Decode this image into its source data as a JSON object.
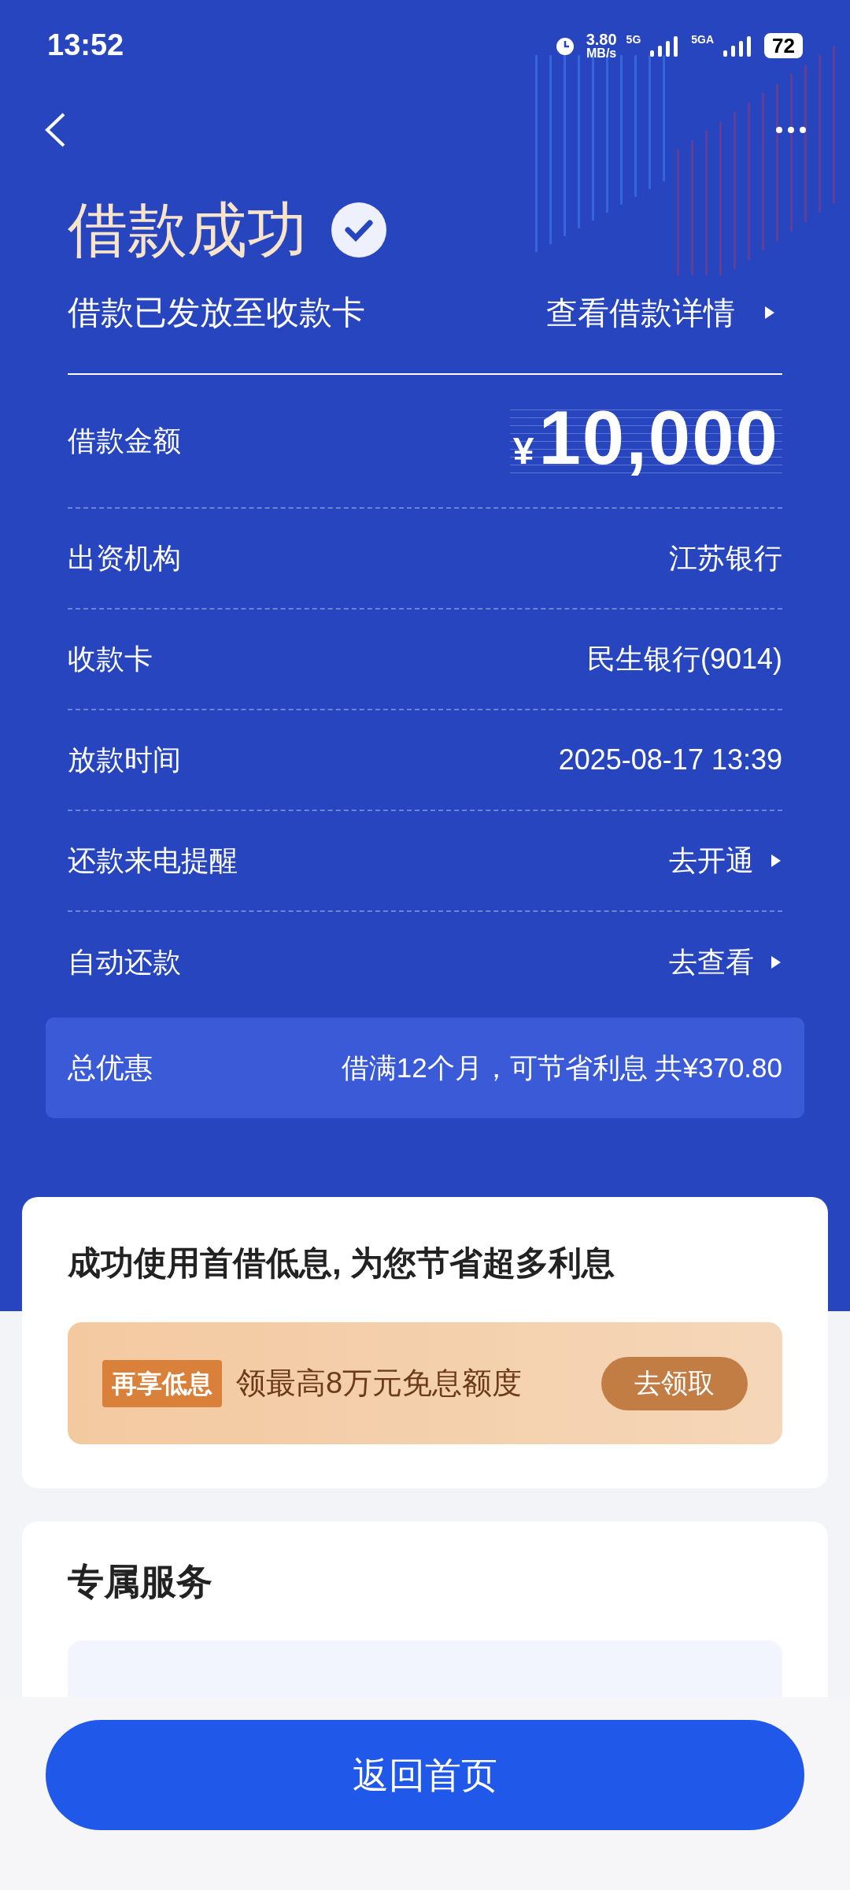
{
  "status_bar": {
    "time": "13:52",
    "speed_value": "3.80",
    "speed_unit": "MB/s",
    "network_1": "5G",
    "network_2": "5GA",
    "battery": "72"
  },
  "header": {
    "title": "借款成功",
    "verified": true,
    "subtitle": "借款已发放至收款卡",
    "details_link": "查看借款详情"
  },
  "rows": [
    {
      "kind": "amount",
      "label": "借款金额",
      "currency": "¥",
      "value": "10,000"
    },
    {
      "kind": "text",
      "label": "出资机构",
      "value": "江苏银行"
    },
    {
      "kind": "text",
      "label": "收款卡",
      "value": "民生银行(9014)"
    },
    {
      "kind": "text",
      "label": "放款时间",
      "value": "2025-08-17 13:39"
    },
    {
      "kind": "link",
      "label": "还款来电提醒",
      "value": "去开通"
    },
    {
      "kind": "link",
      "label": "自动还款",
      "value": "去查看"
    }
  ],
  "discount": {
    "label": "总优惠",
    "text": "借满12个月，可节省利息 共¥370.80"
  },
  "promo_card": {
    "title": "成功使用首借低息, 为您节省超多利息",
    "tag": "再享低息",
    "text": "领最高8万元免息额度",
    "button": "去领取"
  },
  "services": {
    "title": "专属服务"
  },
  "bottom_button": "返回首页"
}
